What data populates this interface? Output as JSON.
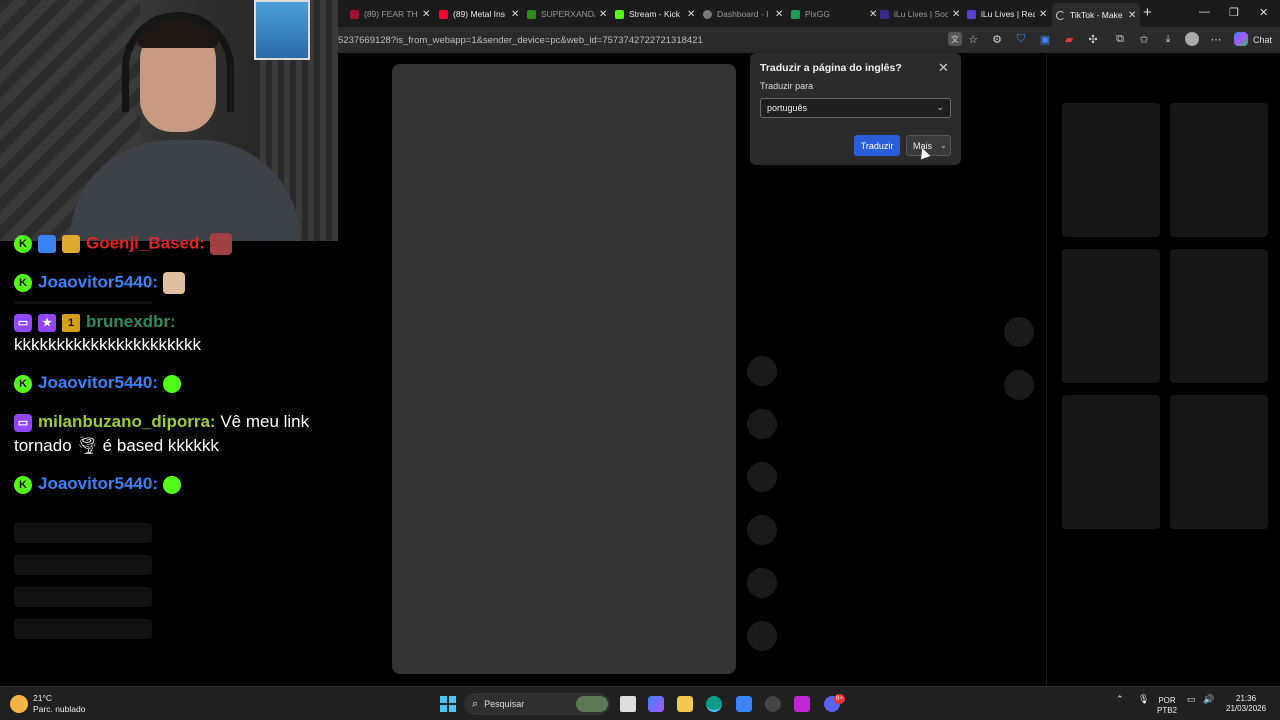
{
  "browser": {
    "tabs": [
      {
        "title": "(89) FEAR THE",
        "icon": "youtube-icon",
        "color": "#ff0033"
      },
      {
        "title": "(89) Metal Ins",
        "icon": "youtube-icon",
        "color": "#ff0033"
      },
      {
        "title": "SUPERXANDA",
        "icon": "kick-icon",
        "color": "#53fc18"
      },
      {
        "title": "Stream - Kick",
        "icon": "kick-icon",
        "color": "#53fc18"
      },
      {
        "title": "Dashboard - I",
        "icon": "globe-icon",
        "color": "#888888"
      },
      {
        "title": "PixGG",
        "icon": "pixgg-icon",
        "color": "#1d9a5a"
      },
      {
        "title": "iLu Lives | Soc",
        "icon": "ilu-icon",
        "color": "#5a3fd6"
      },
      {
        "title": "iLu Lives | Rea",
        "icon": "ilu-icon",
        "color": "#5a3fd6"
      },
      {
        "title": "TikTok - Make",
        "icon": "loading-icon",
        "color": "#cccccc"
      }
    ],
    "url": "5237669128?is_from_webapp=1&sender_device=pc&web_id=7573742722721318421",
    "chat_label": "Chat"
  },
  "chat": {
    "messages": [
      {
        "user": "Goenji_Based:",
        "text": "",
        "platform": "kick",
        "color": "#e02424"
      },
      {
        "user": "Joaovitor5440:",
        "text": "",
        "platform": "kick",
        "color": "#3b82f6"
      },
      {
        "user": "brunexdbr:",
        "text": "kkkkkkkkkkkkkkkkkkkkkk",
        "platform": "twitch",
        "color": "#2e8b57"
      },
      {
        "user": "Joaovitor5440:",
        "text": "",
        "platform": "kick",
        "color": "#3b82f6"
      },
      {
        "user": "milanbuzano_diporra:",
        "text": "Vê meu link",
        "text2": "tornado 🌪 é based kkkkkk",
        "platform": "twitch",
        "color": "#9acd32"
      },
      {
        "user": "Joaovitor5440:",
        "text": "",
        "platform": "kick",
        "color": "#3b82f6"
      }
    ]
  },
  "translate_popup": {
    "title": "Traduzir a página do inglês?",
    "subtitle": "Traduzir para",
    "language": "português",
    "translate_button": "Traduzir",
    "more_button": "Mais"
  },
  "taskbar": {
    "temperature": "21°C",
    "weather": "Parc. nublado",
    "search_placeholder": "Pesquisar",
    "lang_line1": "POR",
    "lang_line2": "PTB2",
    "time": "21:36",
    "date": "21/03/2026",
    "badge_count": "9+"
  },
  "colors": {
    "accent_blue": "#2b5fd9",
    "kick_green": "#53fc18",
    "twitch_purple": "#9146ff"
  }
}
